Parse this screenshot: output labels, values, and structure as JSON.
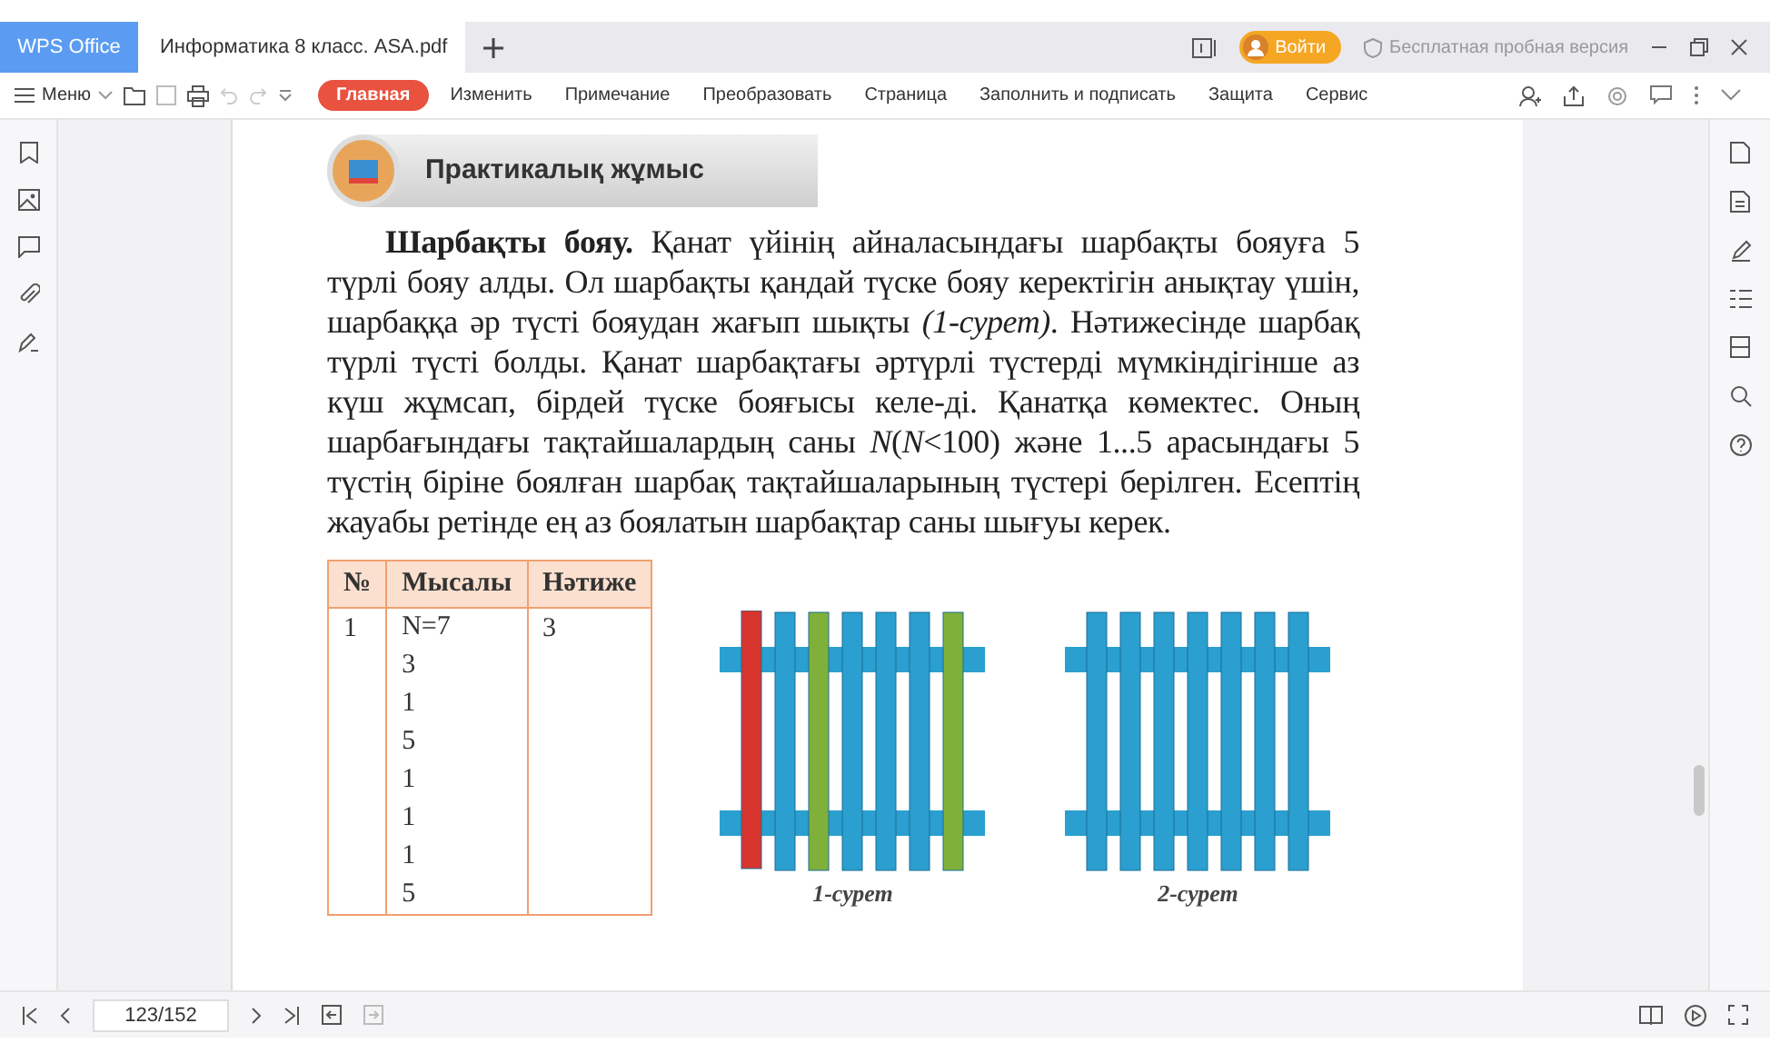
{
  "app_tab": "WPS Office",
  "doc_tab": {
    "title": "Информатика 8 класс. ASA.pdf",
    "selected": true
  },
  "title_bar": {
    "login": "Войти",
    "trial": "Бесплатная пробная версия"
  },
  "menu_button": "Меню",
  "ribbon_tabs": [
    {
      "label": "Главная",
      "selected": true
    },
    {
      "label": "Изменить",
      "selected": false
    },
    {
      "label": "Примечание",
      "selected": false
    },
    {
      "label": "Преобразовать",
      "selected": false
    },
    {
      "label": "Страница",
      "selected": false
    },
    {
      "label": "Заполнить и подписать",
      "selected": false
    },
    {
      "label": "Защита",
      "selected": false
    },
    {
      "label": "Сервис",
      "selected": false
    }
  ],
  "page": {
    "heading": "Практикалық жұмыс",
    "paragraph": "**Шарбақты бояу.** Қанат үйінің айналасындағы шарбақты бояуға 5 түрлі бояу алды. Ол шарбақты қандай түске бояу керектігін анықтау үшін, шарбаққа әр түсті бояудан жағып шықты *(1-сурет)*. Нәтижесінде шарбақ түрлі түсті болды. Қанат шарбақтағы әртүрлі түстерді мүмкіндігінше аз күш жұмсап, бірдей түске бояғысы келе-ді. Қанатқа көмектес. Оның шарбағындағы тақтайшалардың саны *N*(*N*<100) және 1...5 арасындағы 5 түстің біріне боялған шарбақ тақтайшаларының түстері берілген. Есептің жауабы ретінде ең аз боялатын шарбақтар саны шығуы керек.",
    "table": {
      "columns": [
        "№",
        "Мысалы",
        "Нәтиже"
      ],
      "rows": [
        {
          "number": "1",
          "example": [
            "N=7",
            "3",
            "1",
            "5",
            "1",
            "1",
            "1",
            "5"
          ],
          "result": "3"
        }
      ]
    },
    "figures": [
      {
        "caption": "1-сурет",
        "pickets": [
          {
            "color": "#d8352e"
          },
          {
            "color": "#2a9fd0"
          },
          {
            "color": "#7fb03a"
          },
          {
            "color": "#2a9fd0"
          },
          {
            "color": "#2a9fd0"
          },
          {
            "color": "#2a9fd0"
          },
          {
            "color": "#7fb03a"
          }
        ]
      },
      {
        "caption": "2-сурет",
        "pickets": [
          {
            "color": "#2a9fd0"
          },
          {
            "color": "#2a9fd0"
          },
          {
            "color": "#2a9fd0"
          },
          {
            "color": "#2a9fd0"
          },
          {
            "color": "#2a9fd0"
          },
          {
            "color": "#2a9fd0"
          },
          {
            "color": "#2a9fd0"
          }
        ]
      }
    ]
  },
  "page_field": {
    "value": "123/152"
  }
}
